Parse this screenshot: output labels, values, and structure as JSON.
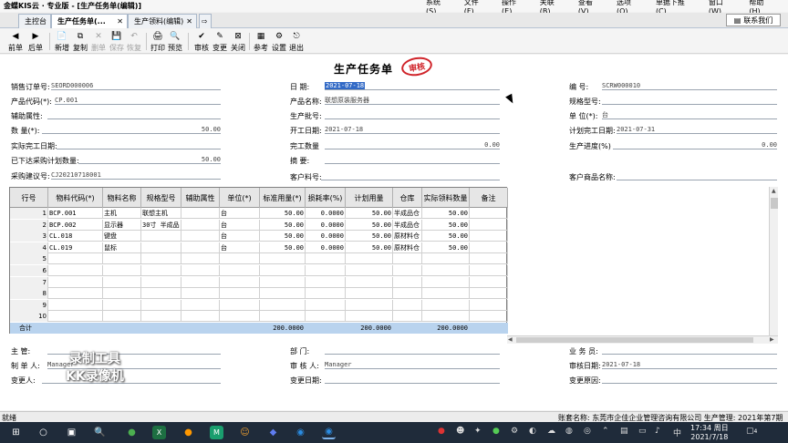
{
  "window": {
    "title": "金蝶KIS云 · 专业版 - [生产任务单(编辑)]",
    "menus": [
      "系统(S)",
      "文件(F)",
      "操作(E)",
      "关联(B)",
      "查看(V)",
      "选项(O)",
      "单据下推(C)",
      "窗口(W)",
      "帮助(H)"
    ]
  },
  "tabs": [
    {
      "label": "主控台"
    },
    {
      "label": "生产任务单(...",
      "active": true
    },
    {
      "label": "生产领料(编辑)"
    }
  ],
  "contact_label": "联系我们",
  "toolbar": {
    "items": [
      {
        "label": "前单",
        "icon": "◀",
        "disabled": false
      },
      {
        "label": "后单",
        "icon": "▶",
        "disabled": false
      },
      {
        "label": "新增",
        "icon": "📄",
        "disabled": false
      },
      {
        "label": "复制",
        "icon": "⧉",
        "disabled": false
      },
      {
        "label": "删单",
        "icon": "✕",
        "disabled": true
      },
      {
        "label": "保存",
        "icon": "💾",
        "disabled": true
      },
      {
        "label": "恢复",
        "icon": "↶",
        "disabled": true
      },
      {
        "label": "打印",
        "icon": "🖨",
        "disabled": false
      },
      {
        "label": "预览",
        "icon": "🔍",
        "disabled": false
      },
      {
        "label": "审核",
        "icon": "✔",
        "disabled": false
      },
      {
        "label": "变更",
        "icon": "✎",
        "disabled": false
      },
      {
        "label": "关闭",
        "icon": "⊠",
        "disabled": false
      },
      {
        "label": "参考",
        "icon": "▦",
        "disabled": false
      },
      {
        "label": "设置",
        "icon": "⚙",
        "disabled": false
      },
      {
        "label": "退出",
        "icon": "⎋",
        "disabled": false
      }
    ]
  },
  "document": {
    "title": "生产任务单",
    "stamp": "审核",
    "fields": {
      "sales_order_label": "销售订单号:",
      "sales_order": "SEORD000006",
      "date_label": "日    期:",
      "date": "2021-07-18",
      "number_label": "编    号:",
      "number": "SCRW000010",
      "product_code_label": "产品代码(*):",
      "product_code": "CP.001",
      "product_name_label": "产品名称:",
      "product_name": "联想原装服务器",
      "spec_label": "规格型号:",
      "spec": "",
      "aux_attr_label": "辅助属性:",
      "aux_attr": "",
      "batch_label": "生产批号:",
      "batch": "",
      "unit_label": "单 位(*):",
      "unit": "台",
      "qty_label": "数 量(*):",
      "qty": "50.00",
      "start_date_label": "开工日期:",
      "start_date": "2021-07-18",
      "planned_finish_label": "计划完工日期:",
      "planned_finish": "2021-07-31",
      "actual_finish_label": "实际完工日期:",
      "actual_finish": "",
      "finished_qty_label": "完工数量",
      "finished_qty": "0.00",
      "progress_label": "生产进度(%)",
      "progress": "0.00",
      "purchase_plan_label": "已下达采购计划数量:",
      "purchase_plan": "50.00",
      "summary_label": "摘    要:",
      "summary": "",
      "purchase_suggest_label": "采购建议号:",
      "purchase_suggest": "CJ20210718001",
      "customer_item_label": "客户料号:",
      "customer_item": "",
      "customer_item_name_label": "客户商品名称:",
      "customer_item_name": ""
    },
    "grid": {
      "headers": [
        "行号",
        "物料代码(*)",
        "物料名称",
        "规格型号",
        "辅助属性",
        "单位(*)",
        "标准用量(*)",
        "损耗率(%)",
        "计划用量",
        "仓库",
        "实际领料数量",
        "备注"
      ],
      "rows": [
        [
          "1",
          "BCP.001",
          "主机",
          "联想主机",
          "",
          "台",
          "50.00",
          "0.0000",
          "50.00",
          "半成品仓",
          "50.00",
          ""
        ],
        [
          "2",
          "BCP.002",
          "显示器",
          "30寸 半成品",
          "",
          "台",
          "50.00",
          "0.0000",
          "50.00",
          "半成品仓",
          "50.00",
          ""
        ],
        [
          "3",
          "CL.018",
          "键盘",
          "",
          "",
          "台",
          "50.00",
          "0.0000",
          "50.00",
          "原材料仓",
          "50.00",
          ""
        ],
        [
          "4",
          "CL.019",
          "鼠标",
          "",
          "",
          "台",
          "50.00",
          "0.0000",
          "50.00",
          "原材料仓",
          "50.00",
          ""
        ],
        [
          "5",
          "",
          "",
          "",
          "",
          "",
          "",
          "",
          "",
          "",
          "",
          ""
        ],
        [
          "6",
          "",
          "",
          "",
          "",
          "",
          "",
          "",
          "",
          "",
          "",
          ""
        ],
        [
          "7",
          "",
          "",
          "",
          "",
          "",
          "",
          "",
          "",
          "",
          "",
          ""
        ],
        [
          "8",
          "",
          "",
          "",
          "",
          "",
          "",
          "",
          "",
          "",
          "",
          ""
        ],
        [
          "9",
          "",
          "",
          "",
          "",
          "",
          "",
          "",
          "",
          "",
          "",
          ""
        ],
        [
          "10",
          "",
          "",
          "",
          "",
          "",
          "",
          "",
          "",
          "",
          "",
          ""
        ]
      ],
      "total_label": "合计",
      "total_std_qty": "200.0000",
      "total_plan_qty": "200.0000",
      "total_actual_qty": "200.0000"
    },
    "footer": {
      "supervisor_label": "主    管:",
      "supervisor": "",
      "dept_label": "部    门:",
      "dept": "",
      "salesman_label": "业 务 员:",
      "salesman": "",
      "maker_label": "制 单 人:",
      "maker": "Manager",
      "auditor_label": "审 核 人:",
      "auditor": "Manager",
      "audit_date_label": "审核日期:",
      "audit_date": "2021-07-18",
      "changer_label": "变更人:",
      "changer": "",
      "change_date_label": "变更日期:",
      "change_date": "",
      "change_reason_label": "变更原因:",
      "change_reason": ""
    }
  },
  "watermark": {
    "line1": "录制工具",
    "line2": "KK录像机"
  },
  "statusbar": {
    "left": "就绪",
    "right": "账套名称: 东莞市企佳企业管理咨询有限公司  生产管理: 2021年第7期"
  },
  "taskbar": {
    "time": "17:34 周日",
    "date": "2021/7/18",
    "notification_count": "4"
  }
}
